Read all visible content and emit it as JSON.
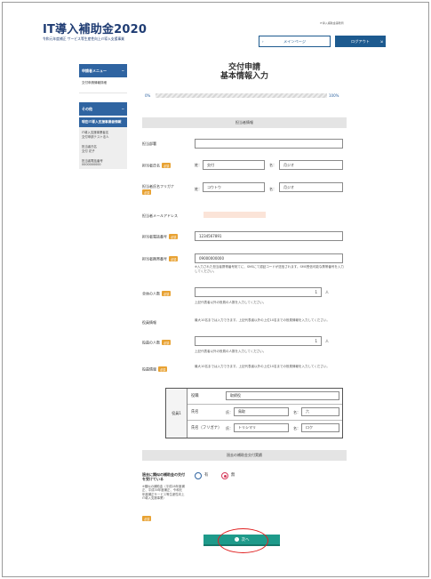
{
  "header": {
    "logo_main": "IT導入補助金2020",
    "logo_sub": "令和元年度補正 サービス等生産性向上IT導入支援事業",
    "top_right_note": "IT導入補助金事務局",
    "menu_button": "メインページ",
    "logout_button": "ログアウト"
  },
  "sidebar": {
    "menu_title": "申請者メニュー",
    "menu_toggle": "−",
    "menu_items": [
      "交付申請情報詳細"
    ],
    "other_title": "その他",
    "other_toggle": "−",
    "highlight": "現在IT導入支援事業者情報",
    "kv": [
      {
        "label": "IT導入支援事業者名",
        "value": "交付申請テスト法人"
      },
      {
        "label": "担当者氏名",
        "value": "交付 花子"
      },
      {
        "label": "担当者電話番号",
        "value": "0000000000"
      }
    ]
  },
  "page": {
    "title_line1": "交付申請",
    "title_line2": "基本情報入力",
    "progress_start": "0%",
    "progress_end": "100%",
    "progress_value": 0
  },
  "section1": {
    "title": "担当者情報",
    "fields": {
      "dept": {
        "label": "担当部署",
        "value": ""
      },
      "name": {
        "label": "担当者氏名",
        "required": "必須",
        "sei_prefix": "姓：",
        "sei": "交付",
        "mei_prefix": "名：",
        "mei": "月ジオ"
      },
      "kana": {
        "label": "担当者氏名フリガナ",
        "required": "必須",
        "sei_prefix": "姓：",
        "sei": "コウトウ",
        "mei_prefix": "名：",
        "mei": "月ジオ"
      },
      "email": {
        "label": "担当者メールアドレス"
      },
      "phone": {
        "label": "担当者電話番号",
        "required": "必須",
        "value": "1234567891"
      },
      "mobile": {
        "label": "担当者携帯番号",
        "required": "必須",
        "value": "09000000000",
        "note": "※入力された担当者携帯番号宛てに、SMSにて認証コードが送信されます。SMS受信可能な携帯番号を入力してください。"
      },
      "employees": {
        "label": "全体の人数",
        "required": "必須",
        "value": "1",
        "unit": "人",
        "note": "上記代表者以外の役員の人数を入力してください。"
      },
      "officers_info": {
        "label": "役員情報",
        "note": "最大10名までは入力できます。上記代表者以外の上位10名までの役員情報を入力してください。"
      },
      "officer_count": {
        "label": "役員の人数",
        "required": "必須",
        "value": "1",
        "unit": "人",
        "note": "上記代表者以外の役員の人数を入力してください。"
      },
      "officer_info2": {
        "label": "役員情報",
        "required": "必須",
        "note": "最大10名までは入力できます。上記代表者以外の上位10名までの役員情報を入力してください。"
      }
    },
    "officer_table": {
      "row_label": "役員1",
      "title_label": "役職",
      "title_value": "取締役",
      "name_label": "氏名",
      "sei_prefix": "氏：",
      "sei": "鳥取",
      "mei_prefix": "名：",
      "mei": "六",
      "kana_label": "氏名（フリガナ）",
      "kana_sei_prefix": "氏：",
      "kana_sei": "トリシマリ",
      "kana_mei_prefix": "名：",
      "kana_mei": "ロク"
    }
  },
  "section2": {
    "title": "過去の補助金交付実績",
    "question": "過去に類似の補助金の交付を受けている",
    "question_note": "※類似の補助金（平成28年度補正、平成30年度補正、令和元年度補正サービス等生産性向上IT導入支援事業）",
    "required": "必須",
    "options": [
      {
        "label": "有",
        "selected": false
      },
      {
        "label": "無",
        "selected": true
      }
    ]
  },
  "footer": {
    "next_button": "次へ",
    "next_icon": "›"
  },
  "colors": {
    "primary": "#2f64a1",
    "required": "#e8a233",
    "next": "#1e9a8a",
    "highlight_ellipse": "#e02020"
  }
}
